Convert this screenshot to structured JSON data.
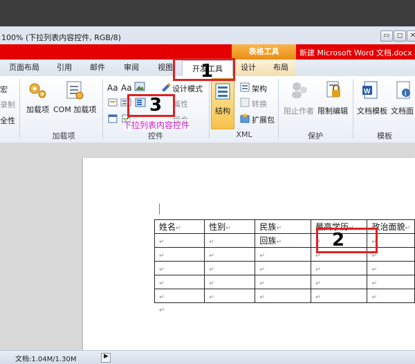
{
  "title_bar": {
    "title": "100% (下拉列表内容控件, RGB/8)"
  },
  "context_bar": {
    "context_tab_group": "表格工具",
    "document_title": "新建 Microsoft Word 文档.docx"
  },
  "tabs": [
    {
      "label": "页面布局"
    },
    {
      "label": "引用"
    },
    {
      "label": "邮件"
    },
    {
      "label": "审阅"
    },
    {
      "label": "视图"
    },
    {
      "label": "开发工具",
      "active": true
    },
    {
      "label": "设计"
    },
    {
      "label": "布局"
    }
  ],
  "ribbon": {
    "code_group": {
      "items": [
        "宏",
        "录制",
        "全性"
      ]
    },
    "addins_group": {
      "label": "加载项",
      "addins_button": "加载项",
      "com_addins_button": "COM 加载项"
    },
    "controls_group": {
      "label": "控件",
      "rich_text_glyph": "Aa",
      "plain_text_glyph": "Aa",
      "design_mode": "设计模式",
      "properties": "属性",
      "group": "组合",
      "tooltip": "下拉列表内容控件"
    },
    "xml_group": {
      "label": "XML",
      "structure": "结构",
      "schema": "架构",
      "transform": "转换",
      "expansion_pack": "扩展包"
    },
    "protect_group": {
      "label": "保护",
      "block_authors": "阻止作者",
      "restrict_editing": "限制编辑"
    },
    "templates_group": {
      "label": "模板",
      "document_template": "文档模板",
      "document_panel": "文档面"
    }
  },
  "table": {
    "headers": [
      "姓名",
      "性别",
      "民族",
      "最高学历",
      "政治面貌"
    ],
    "rows": [
      [
        "",
        "",
        "回族",
        "",
        ""
      ],
      [
        "",
        "",
        "",
        "",
        ""
      ],
      [
        "",
        "",
        "",
        "",
        ""
      ],
      [
        "",
        "",
        "",
        "",
        ""
      ],
      [
        "",
        "",
        "",
        "",
        ""
      ]
    ]
  },
  "status_bar": {
    "doc_size": "文档:1.04M/1.30M"
  },
  "annotations": {
    "step1": "1",
    "step2": "2",
    "step3": "3"
  },
  "colors": {
    "annotation_red": "#e02020",
    "context_strip": "#e40000",
    "context_tab": "#f0a030"
  }
}
